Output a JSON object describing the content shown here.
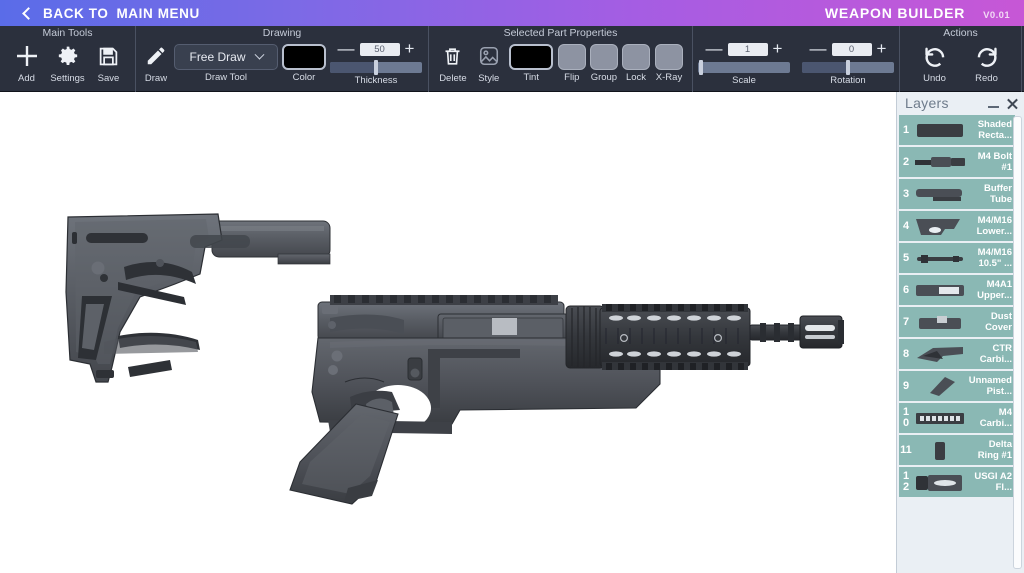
{
  "header": {
    "back_label": "BACK TO",
    "menu_label": "MAIN MENU",
    "title": "WEAPON BUILDER",
    "version": "V0.01",
    "gradient_start": "#5a6ce8",
    "gradient_end": "#c757d6"
  },
  "toolbar": {
    "sections": [
      {
        "title": "Main Tools"
      },
      {
        "title": "Drawing"
      },
      {
        "title": "Selected Part Properties"
      },
      {
        "title": ""
      },
      {
        "title": "Actions"
      }
    ],
    "main_tools": [
      {
        "label": "Add",
        "icon": "plus-icon"
      },
      {
        "label": "Settings",
        "icon": "gear-icon"
      },
      {
        "label": "Save",
        "icon": "floppy-disk-icon"
      }
    ],
    "drawing": {
      "draw_label": "Draw",
      "draw_icon": "pencil-icon",
      "draw_tool_label": "Draw Tool",
      "draw_tool_value": "Free Draw",
      "color_label": "Color",
      "color_value": "#000000",
      "thickness_label": "Thickness",
      "thickness_value": "50",
      "minus": "—",
      "plus": "+"
    },
    "part_properties": [
      {
        "label": "Delete",
        "icon": "trash-icon"
      },
      {
        "label": "Style",
        "icon": "style-icon"
      },
      {
        "label": "Tint",
        "icon": "color-swatch"
      },
      {
        "label": "Flip",
        "icon": "flip-button"
      },
      {
        "label": "Group",
        "icon": "group-button"
      },
      {
        "label": "Lock",
        "icon": "lock-button"
      },
      {
        "label": "X-Ray",
        "icon": "xray-button"
      }
    ],
    "tint_value": "#000000",
    "transform": {
      "scale_label": "Scale",
      "scale_value": "1",
      "rotation_label": "Rotation",
      "rotation_value": "0"
    },
    "actions": [
      {
        "label": "Undo",
        "icon": "undo-icon"
      },
      {
        "label": "Redo",
        "icon": "redo-icon"
      }
    ]
  },
  "layers": {
    "title": "Layers",
    "minimize": "minimize-icon",
    "close": "close-icon",
    "items": [
      {
        "num": "1",
        "name": "Shaded Recta...",
        "thumb": "shaded-rectangle"
      },
      {
        "num": "2",
        "name": "M4 Bolt #1",
        "thumb": "bolt-carrier"
      },
      {
        "num": "3",
        "name": "Buffer Tube",
        "thumb": "buffer-tube"
      },
      {
        "num": "4",
        "name": "M4/M16 Lower...",
        "thumb": "lower-receiver"
      },
      {
        "num": "5",
        "name": "M4/M16 10.5\" ...",
        "thumb": "barrel"
      },
      {
        "num": "6",
        "name": "M4A1 Upper...",
        "thumb": "upper-receiver"
      },
      {
        "num": "7",
        "name": "Dust Cover",
        "thumb": "dust-cover"
      },
      {
        "num": "8",
        "name": "CTR Carbi...",
        "thumb": "ctr-stock"
      },
      {
        "num": "9",
        "name": "Unnamed Pist...",
        "thumb": "pistol-grip"
      },
      {
        "num": "10",
        "name": "M4 Carbi...",
        "thumb": "handguard"
      },
      {
        "num": "11",
        "name": "Delta Ring #1",
        "thumb": "delta-ring"
      },
      {
        "num": "12",
        "name": "USGI A2 Fl...",
        "thumb": "flash-hider"
      }
    ],
    "item_color": "#8ab8b4",
    "panel_bg": "#eaeff4"
  },
  "canvas": {
    "weapon_name": "AR-15 carbine assembly",
    "body_color": "#5b5f66",
    "dark_color": "#3b3e44"
  }
}
